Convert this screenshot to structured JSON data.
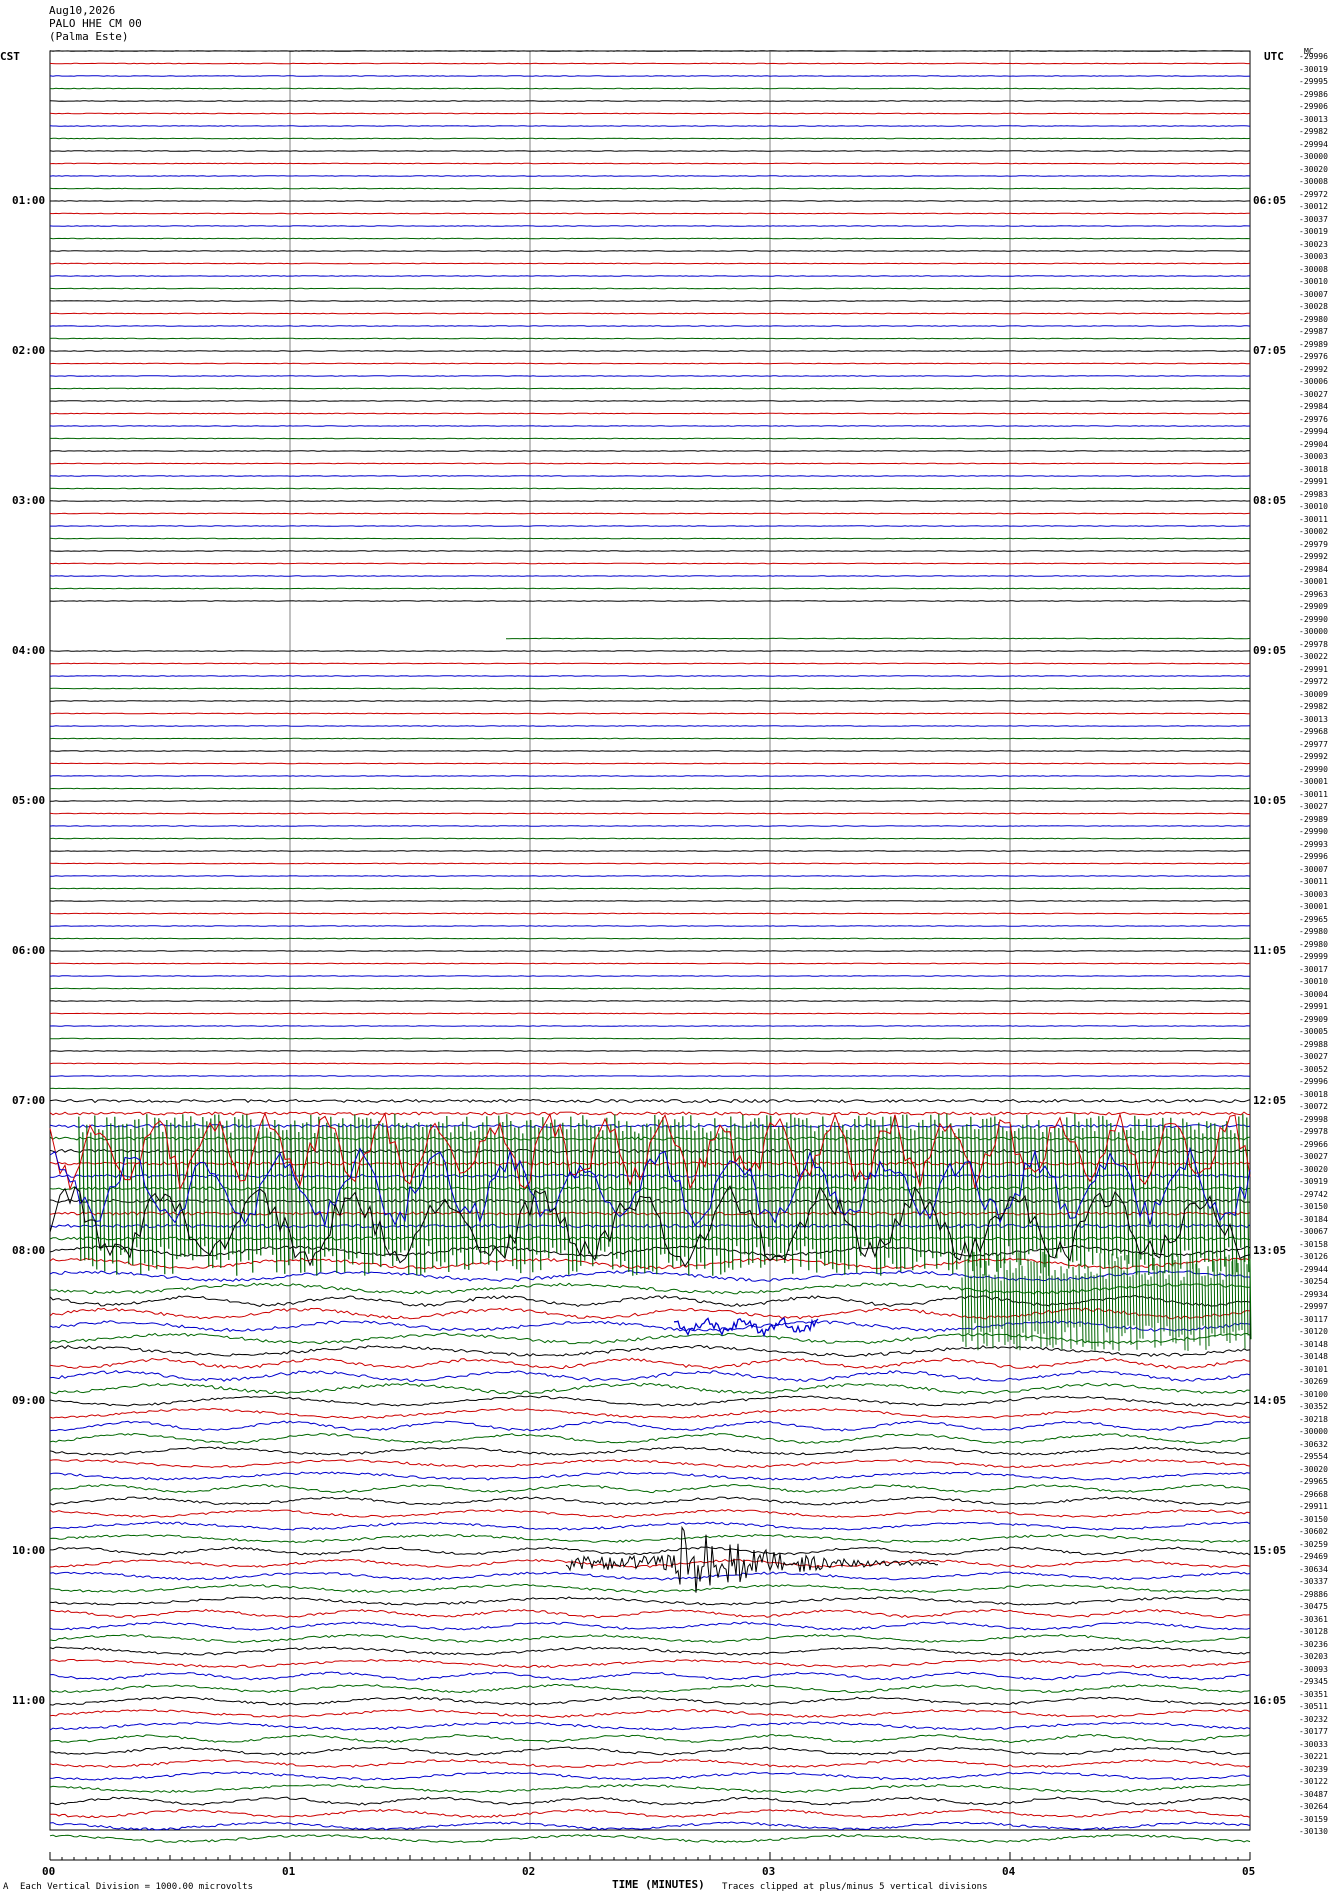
{
  "header": {
    "date": "Aug10,2026",
    "station": "PALO HHE CM 00",
    "location": "(Palma Este)"
  },
  "left_tz": "CST",
  "right_tz": "UTC",
  "right_top_label": "MC",
  "colors": {
    "trace_cycle": [
      "#000000",
      "#cc0000",
      "#0000cc",
      "#006600"
    ],
    "gridline": "#808080",
    "frame": "#000000"
  },
  "footer": {
    "xlabel": "TIME (MINUTES)",
    "scale": "Each Vertical Division = 1000.00 microvolts",
    "clip_note": "Traces clipped at plus/minus 5 vertical divisions",
    "corner_mark": "A"
  },
  "chart_data": {
    "type": "line",
    "title": "Aug10,2026 PALO HHE CM 00 (Palma Este)",
    "xlabel": "TIME (MINUTES)",
    "xlim": [
      0,
      5
    ],
    "x_ticks": [
      "00",
      "01",
      "02",
      "03",
      "04",
      "05"
    ],
    "ylim_trace_rows": [
      0,
      144
    ],
    "trace_minutes": 5,
    "left_time_labels": [
      "01:00",
      "02:00",
      "03:00",
      "04:00",
      "05:00",
      "06:00",
      "07:00",
      "08:00",
      "09:00",
      "10:00",
      "11:00"
    ],
    "right_time_labels": [
      "06:05",
      "07:05",
      "08:05",
      "09:05",
      "10:05",
      "11:05",
      "12:05",
      "13:05",
      "14:05",
      "15:05",
      "16:05"
    ],
    "time_label_rows": [
      12,
      24,
      36,
      48,
      60,
      72,
      84,
      96,
      108,
      120,
      132
    ],
    "offset_labels": [
      "-29996",
      "-30019",
      "-29995",
      "-29986",
      "-29906",
      "-30013",
      "-29982",
      "-29994",
      "-30000",
      "-30020",
      "-30008",
      "-29972",
      "-30012",
      "-30037",
      "-30019",
      "-30023",
      "-30003",
      "-30008",
      "-30010",
      "-30007",
      "-30028",
      "-29980",
      "-29987",
      "-29989",
      "-29976",
      "-29992",
      "-30006",
      "-30027",
      "-29984",
      "-29976",
      "-29994",
      "-29904",
      "-30003",
      "-30018",
      "-29991",
      "-29983",
      "-30010",
      "-30011",
      "-30002",
      "-29979",
      "-29992",
      "-29984",
      "-30001",
      "-29963",
      "-29909",
      "-29990",
      "-30000",
      "-29978",
      "-30022",
      "-29991",
      "-29972",
      "-30009",
      "-29982",
      "-30013",
      "-29968",
      "-29977",
      "-29992",
      "-29990",
      "-30001",
      "-30011",
      "-30027",
      "-29989",
      "-29990",
      "-29993",
      "-29996",
      "-30007",
      "-30011",
      "-30003",
      "-30001",
      "-29965",
      "-29980",
      "-29980",
      "-29999",
      "-30017",
      "-30010",
      "-30004",
      "-29991",
      "-29909",
      "-30005",
      "-29988",
      "-30027",
      "-30052",
      "-29996",
      "-30018",
      "-30072",
      "-29998",
      "-29978",
      "-29966",
      "-30027",
      "-30020",
      "-30919",
      "-29742",
      "-30150",
      "-30184",
      "-30067",
      "-30158",
      "-30126",
      "-29944",
      "-30254",
      "-29934",
      "-29997",
      "-30117",
      "-30120",
      "-30148",
      "-30148",
      "-30101",
      "-30269",
      "-30100",
      "-30352",
      "-30218",
      "-30000",
      "-30632",
      "-29554",
      "-30020",
      "-29965",
      "-29668",
      "-29911",
      "-30150",
      "-30602",
      "-30259",
      "-29469",
      "-30634",
      "-30337",
      "-29886",
      "-30475",
      "-30361",
      "-30128",
      "-30236",
      "-30203",
      "-30093",
      "-29345",
      "-30351",
      "-30511",
      "-30232",
      "-30177",
      "-30033",
      "-30221",
      "-30239",
      "-30122",
      "-30487",
      "-30264",
      "-30159",
      "-30130"
    ],
    "events": [
      {
        "name": "saturated-noise",
        "rows_start": 85,
        "rows_end": 105,
        "x_start": 0,
        "x_end": 5
      },
      {
        "name": "local-event",
        "row": 121,
        "x_start": 2.15,
        "x_end": 3.7,
        "peak_minute": 2.62
      },
      {
        "name": "blue-burst",
        "row": 102,
        "x_start": 2.6,
        "x_end": 3.2
      }
    ],
    "data_gap": {
      "row_start": 44,
      "row_end": 47,
      "x_start": 0.6,
      "x_end": 1.9
    },
    "grid": true
  }
}
